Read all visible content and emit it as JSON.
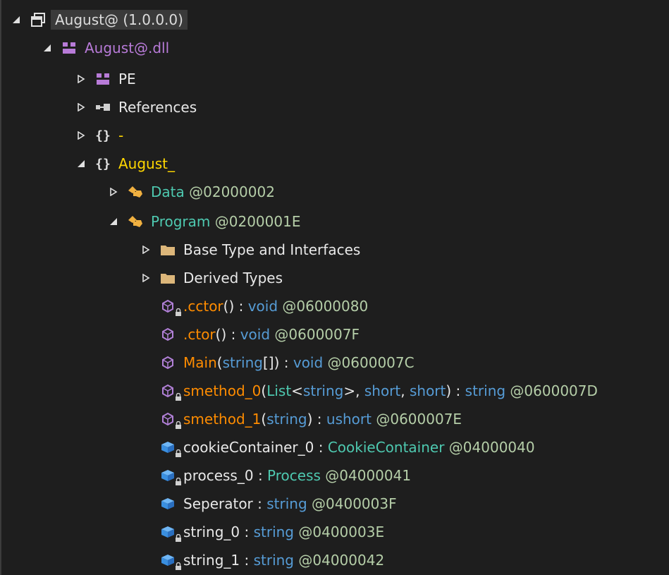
{
  "tree": {
    "root": {
      "label": "August@ (1.0.0.0)"
    },
    "module": {
      "label": "August@.dll"
    },
    "pe": {
      "label": "PE"
    },
    "references": {
      "label": "References"
    },
    "ns_empty": {
      "label": "-"
    },
    "ns_august": {
      "label": "August_"
    },
    "data_class": {
      "name": "Data",
      "token": " @02000002"
    },
    "program_class": {
      "name": "Program",
      "token": " @0200001E"
    },
    "base_types": {
      "label": "Base Type and Interfaces"
    },
    "derived_types": {
      "label": "Derived Types"
    },
    "members": [
      {
        "name": ".cctor",
        "sig_open": "()",
        "sep": " : ",
        "ret": "void",
        "token": " @06000080"
      },
      {
        "name": ".ctor",
        "sig_open": "()",
        "sep": " : ",
        "ret": "void",
        "token": " @0600007F"
      },
      {
        "name": "Main",
        "p1": "(",
        "t1": "string",
        "p2": "[]) ",
        "sep": ": ",
        "ret": "void",
        "token": " @0600007C"
      },
      {
        "name": "smethod_0",
        "p1": "(",
        "t1": "List",
        "p2": "<",
        "t2": "string",
        "p3": ">, ",
        "t3": "short",
        "p4": ", ",
        "t4": "short",
        "p5": ") ",
        "sep": ": ",
        "ret": "string",
        "token": " @0600007D"
      },
      {
        "name": "smethod_1",
        "p1": "(",
        "t1": "string",
        "p2": ") ",
        "sep": ": ",
        "ret": "ushort",
        "token": " @0600007E"
      },
      {
        "name": "cookieContainer_0",
        "sep": " : ",
        "ret": "CookieContainer",
        "token": " @04000040"
      },
      {
        "name": "process_0",
        "sep": " : ",
        "ret": "Process",
        "token": " @04000041"
      },
      {
        "name": "Seperator",
        "sep": " : ",
        "ret": "string",
        "token": " @0400003F"
      },
      {
        "name": "string_0",
        "sep": " : ",
        "ret": "string",
        "token": " @0400003E"
      },
      {
        "name": "string_1",
        "sep": " : ",
        "ret": "string",
        "token": " @04000042"
      }
    ]
  },
  "colors": {
    "background": "#1e1e1e",
    "selection": "#3a3a3a",
    "namespace": "#ffd700",
    "type": "#4ec9b0",
    "keyword": "#569cd6",
    "method": "#ff8c00",
    "module": "#b87bd8",
    "folder": "#dcb67a",
    "field_icon": "#4a9fe8",
    "method_icon": "#b180d7"
  },
  "icons": {
    "root": "assembly-icon",
    "module": "module-icon",
    "pe": "module-icon",
    "references": "references-icon",
    "namespace": "namespace-icon",
    "class": "class-icon",
    "folder": "folder-icon",
    "method": "method-icon",
    "field": "field-icon",
    "lock": "lock-icon"
  }
}
